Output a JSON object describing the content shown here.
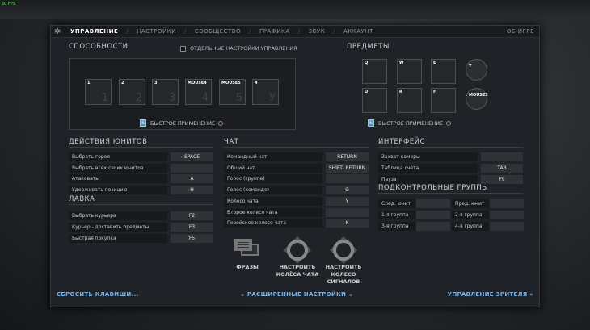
{
  "fps": "60 FPS",
  "tabs": [
    "УПРАВЛЕНИЕ",
    "НАСТРОЙКИ",
    "СООБЩЕСТВО",
    "ГРАФИКА",
    "ЗВУК",
    "АККАУНТ"
  ],
  "about": "ОБ ИГРЕ",
  "abilities": {
    "title": "СПОСОБНОСТИ",
    "separate_label": "ОТДЕЛЬНЫЕ НАСТРОЙКИ УПРАВЛЕНИЯ",
    "slots": [
      {
        "key": "1",
        "num": "1"
      },
      {
        "key": "2",
        "num": "2"
      },
      {
        "key": "3",
        "num": "3"
      },
      {
        "key": "MOUSE4",
        "num": "4"
      },
      {
        "key": "MOUSE5",
        "num": "5"
      },
      {
        "key": "4",
        "num": "У"
      }
    ],
    "quickcast": "БЫСТРОЕ ПРИМЕНЕНИЕ"
  },
  "items": {
    "title": "ПРЕДМЕТЫ",
    "slots": [
      "Q",
      "W",
      "E",
      "D",
      "R",
      "F"
    ],
    "neutral": "T",
    "tp": "MOUSE3",
    "quickcast": "БЫСТРОЕ ПРИМЕНЕНИЕ"
  },
  "unit_actions": {
    "title": "ДЕЙСТВИЯ ЮНИТОВ",
    "rows": [
      {
        "label": "Выбрать героя",
        "key": "SPACE"
      },
      {
        "label": "Выбрать всех своих юнитов",
        "key": ""
      },
      {
        "label": "Атаковать",
        "key": "A"
      },
      {
        "label": "Удерживать позицию",
        "key": "H"
      }
    ]
  },
  "shop": {
    "title": "ЛАВКА",
    "rows": [
      {
        "label": "Выбрать курьера",
        "key": "F2"
      },
      {
        "label": "Курьер - доставить предметы",
        "key": "F3"
      },
      {
        "label": "Быстрая покупка",
        "key": "F5"
      }
    ]
  },
  "chat": {
    "title": "ЧАТ",
    "rows": [
      {
        "label": "Командный чат",
        "key": "RETURN"
      },
      {
        "label": "Общий чат",
        "key": "SHIFT- RETURN"
      },
      {
        "label": "Голос (группе)",
        "key": ""
      },
      {
        "label": "Голос (команде)",
        "key": "G"
      },
      {
        "label": "Колесо чата",
        "key": "Y"
      },
      {
        "label": "Второе колесо чата",
        "key": ""
      },
      {
        "label": "Геройское колесо чата",
        "key": "K"
      }
    ]
  },
  "interface": {
    "title": "ИНТЕРФЕЙС",
    "rows": [
      {
        "label": "Захват камеры",
        "key": ""
      },
      {
        "label": "Таблица счёта",
        "key": "TAB"
      },
      {
        "label": "Пауза",
        "key": "F9"
      }
    ]
  },
  "control_groups": {
    "title": "ПОДКОНТРОЛЬНЫЕ ГРУППЫ",
    "rows": [
      [
        "След. юнит",
        "Пред. юнит"
      ],
      [
        "1-я группа",
        "2-я группа"
      ],
      [
        "3-я группа",
        "4-я группа"
      ]
    ]
  },
  "tools": {
    "phrases": "ФРАЗЫ",
    "chat_wheel": "НАСТРОИТЬ КОЛЁСА ЧАТА",
    "signal_wheel": "НАСТРОИТЬ КОЛЕСО СИГНАЛОВ"
  },
  "footer": {
    "reset": "СБРОСИТЬ КЛАВИШИ...",
    "advanced": "РАСШИРЕННЫЕ НАСТРОЙКИ",
    "spectator": "УПРАВЛЕНИЕ ЗРИТЕЛЯ »"
  }
}
